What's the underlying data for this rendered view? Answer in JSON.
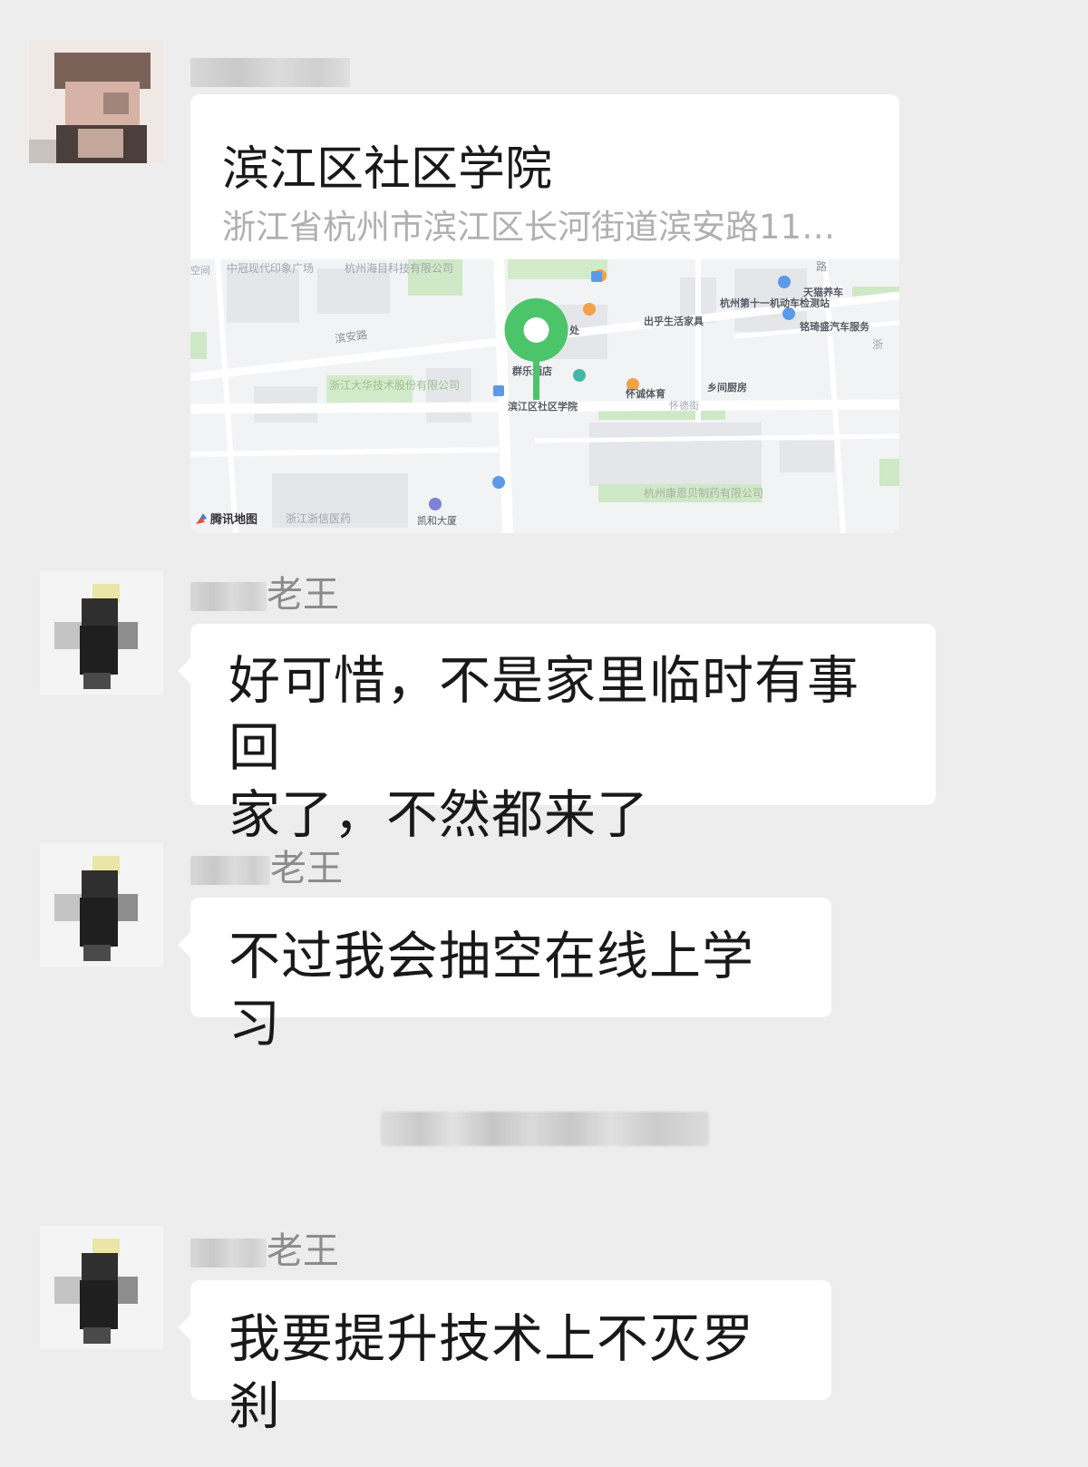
{
  "colors": {
    "background": "#ededed",
    "bubble": "#ffffff",
    "name": "#8c8c8c",
    "pin": "#4cc46a"
  },
  "messages": [
    {
      "type": "location",
      "sender_name": "",
      "location": {
        "title": "滨江区社区学院",
        "address": "浙江省杭州市滨江区长河街道滨安路11…",
        "map_brand": "腾讯地图",
        "map_labels": {
          "l1": "中冠现代印象广场",
          "l2": "杭州海目科技有限公司",
          "l3": "滨安路",
          "l4": "浙江大华技术股份有限公司",
          "l5": "群乐酒店",
          "l6": "滨江区社区学院",
          "l7": "出乎生活家具",
          "l8": "杭州第十一机动车检测站",
          "l9": "天猫养车",
          "l10": "铭琦盛汽车服务",
          "l11": "怀诚体育",
          "l12": "乡间厨房",
          "l13": "怀德街",
          "l14": "杭州康恩贝制药有限公司",
          "l15": "浙江浙信医药",
          "l16": "凯和大厦",
          "l17": "路",
          "l18": "处",
          "l19": "浙",
          "l20": "空间"
        }
      }
    },
    {
      "type": "text",
      "sender_name": "老王",
      "text": "好可惜，不是家里临时有事回\n家了，不然都来了"
    },
    {
      "type": "text",
      "sender_name": "老王",
      "text": "不过我会抽空在线上学习"
    },
    {
      "type": "text",
      "sender_name": "老王",
      "text": "我要提升技术上不灭罗刹"
    }
  ]
}
